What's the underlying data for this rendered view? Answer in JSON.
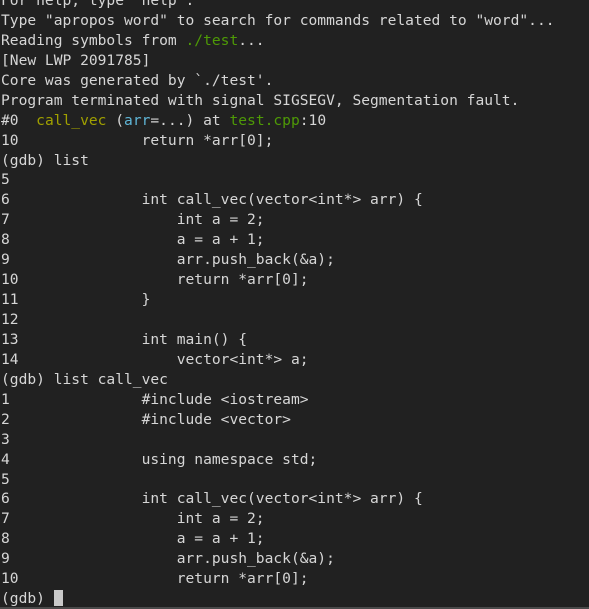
{
  "terminal": {
    "title": "gdb",
    "background_color": "#212121",
    "foreground_color": "#d6d6d6",
    "cursor_color": "#c9c9c9",
    "colors": {
      "green": "#4e9a06",
      "olive": "#a0a000",
      "cyan": "#5fb5d6",
      "default": "#d6d6d6"
    },
    "prompt": "(gdb) ",
    "cursor_glyph": "block"
  },
  "lines": [
    {
      "id": "line-help-hint",
      "segments": [
        {
          "text": "For help, type \"help\".",
          "color": "default"
        }
      ]
    },
    {
      "id": "line-apropos-hint",
      "segments": [
        {
          "text": "Type \"apropos word\" to search for commands related to \"word\"...",
          "color": "default"
        }
      ]
    },
    {
      "id": "line-reading-symbols",
      "segments": [
        {
          "text": "Reading symbols from ",
          "color": "default"
        },
        {
          "text": "./test",
          "color": "green"
        },
        {
          "text": "...",
          "color": "default"
        }
      ]
    },
    {
      "id": "line-new-lwp",
      "segments": [
        {
          "text": "[New LWP 2091785]",
          "color": "default"
        }
      ]
    },
    {
      "id": "line-core-generated",
      "segments": [
        {
          "text": "Core was generated by `./test'.",
          "color": "default"
        }
      ]
    },
    {
      "id": "line-program-terminated",
      "segments": [
        {
          "text": "Program terminated with signal SIGSEGV, Segmentation fault.",
          "color": "default"
        }
      ]
    },
    {
      "id": "line-frame-0",
      "segments": [
        {
          "text": "#0  ",
          "color": "default"
        },
        {
          "text": "call_vec",
          "color": "olive"
        },
        {
          "text": " (",
          "color": "default"
        },
        {
          "text": "arr",
          "color": "cyan"
        },
        {
          "text": "=...) at ",
          "color": "default"
        },
        {
          "text": "test.cpp",
          "color": "green"
        },
        {
          "text": ":10",
          "color": "default"
        }
      ]
    },
    {
      "id": "line-frame-0-source",
      "segments": [
        {
          "text": "10\t        return *arr[0];",
          "color": "default"
        }
      ]
    },
    {
      "id": "line-prompt-list",
      "segments": [
        {
          "text": "(gdb) list",
          "color": "default"
        }
      ]
    },
    {
      "id": "line-src-5a",
      "segments": [
        {
          "text": "5\t",
          "color": "default"
        }
      ]
    },
    {
      "id": "line-src-6a",
      "segments": [
        {
          "text": "6\t        int call_vec(vector<int*> arr) {",
          "color": "default"
        }
      ]
    },
    {
      "id": "line-src-7a",
      "segments": [
        {
          "text": "7\t            int a = 2;",
          "color": "default"
        }
      ]
    },
    {
      "id": "line-src-8a",
      "segments": [
        {
          "text": "8\t            a = a + 1;",
          "color": "default"
        }
      ]
    },
    {
      "id": "line-src-9a",
      "segments": [
        {
          "text": "9\t            arr.push_back(&a);",
          "color": "default"
        }
      ]
    },
    {
      "id": "line-src-10a",
      "segments": [
        {
          "text": "10\t            return *arr[0];",
          "color": "default"
        }
      ]
    },
    {
      "id": "line-src-11a",
      "segments": [
        {
          "text": "11\t        }",
          "color": "default"
        }
      ]
    },
    {
      "id": "line-src-12a",
      "segments": [
        {
          "text": "12\t",
          "color": "default"
        }
      ]
    },
    {
      "id": "line-src-13a",
      "segments": [
        {
          "text": "13\t        int main() {",
          "color": "default"
        }
      ]
    },
    {
      "id": "line-src-14a",
      "segments": [
        {
          "text": "14\t            vector<int*> a;",
          "color": "default"
        }
      ]
    },
    {
      "id": "line-prompt-list-callvec",
      "segments": [
        {
          "text": "(gdb) list call_vec",
          "color": "default"
        }
      ]
    },
    {
      "id": "line-src-1b",
      "segments": [
        {
          "text": "1\t        #include <iostream>",
          "color": "default"
        }
      ]
    },
    {
      "id": "line-src-2b",
      "segments": [
        {
          "text": "2\t        #include <vector>",
          "color": "default"
        }
      ]
    },
    {
      "id": "line-src-3b",
      "segments": [
        {
          "text": "3\t",
          "color": "default"
        }
      ]
    },
    {
      "id": "line-src-4b",
      "segments": [
        {
          "text": "4\t        using namespace std;",
          "color": "default"
        }
      ]
    },
    {
      "id": "line-src-5b",
      "segments": [
        {
          "text": "5\t",
          "color": "default"
        }
      ]
    },
    {
      "id": "line-src-6b",
      "segments": [
        {
          "text": "6\t        int call_vec(vector<int*> arr) {",
          "color": "default"
        }
      ]
    },
    {
      "id": "line-src-7b",
      "segments": [
        {
          "text": "7\t            int a = 2;",
          "color": "default"
        }
      ]
    },
    {
      "id": "line-src-8b",
      "segments": [
        {
          "text": "8\t            a = a + 1;",
          "color": "default"
        }
      ]
    },
    {
      "id": "line-src-9b",
      "segments": [
        {
          "text": "9\t            arr.push_back(&a);",
          "color": "default"
        }
      ]
    },
    {
      "id": "line-src-10b",
      "segments": [
        {
          "text": "10\t            return *arr[0];",
          "color": "default"
        }
      ]
    },
    {
      "id": "line-prompt-active",
      "is_prompt": true,
      "segments": [
        {
          "text": "(gdb) ",
          "color": "default"
        }
      ]
    }
  ]
}
